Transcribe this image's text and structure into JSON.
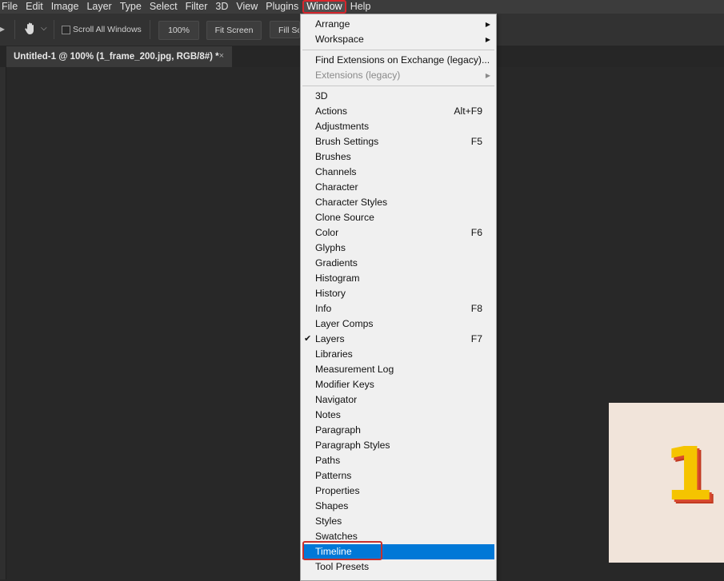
{
  "menubar": {
    "items": [
      "File",
      "Edit",
      "Image",
      "Layer",
      "Type",
      "Select",
      "Filter",
      "3D",
      "View",
      "Plugins",
      "Window",
      "Help"
    ],
    "active": "Window"
  },
  "options": {
    "scroll_all_windows": "Scroll All Windows",
    "zoom_value": "100%",
    "fit_screen": "Fit Screen",
    "fill_screen": "Fill Sc"
  },
  "document": {
    "tab_title": "Untitled-1 @ 100% (1_frame_200.jpg, RGB/8#) *",
    "close_glyph": "×",
    "canvas_number": "1"
  },
  "window_menu": {
    "group1": [
      {
        "label": "Arrange",
        "submenu": true
      },
      {
        "label": "Workspace",
        "submenu": true
      }
    ],
    "group2": [
      {
        "label": "Find Extensions on Exchange (legacy)...",
        "disabled": false
      },
      {
        "label": "Extensions (legacy)",
        "disabled": true,
        "submenu": true
      }
    ],
    "panels": [
      {
        "label": "3D"
      },
      {
        "label": "Actions",
        "shortcut": "Alt+F9"
      },
      {
        "label": "Adjustments"
      },
      {
        "label": "Brush Settings",
        "shortcut": "F5"
      },
      {
        "label": "Brushes"
      },
      {
        "label": "Channels"
      },
      {
        "label": "Character"
      },
      {
        "label": "Character Styles"
      },
      {
        "label": "Clone Source"
      },
      {
        "label": "Color",
        "shortcut": "F6"
      },
      {
        "label": "Glyphs"
      },
      {
        "label": "Gradients"
      },
      {
        "label": "Histogram"
      },
      {
        "label": "History"
      },
      {
        "label": "Info",
        "shortcut": "F8"
      },
      {
        "label": "Layer Comps"
      },
      {
        "label": "Layers",
        "shortcut": "F7",
        "checked": true
      },
      {
        "label": "Libraries"
      },
      {
        "label": "Measurement Log"
      },
      {
        "label": "Modifier Keys"
      },
      {
        "label": "Navigator"
      },
      {
        "label": "Notes"
      },
      {
        "label": "Paragraph"
      },
      {
        "label": "Paragraph Styles"
      },
      {
        "label": "Paths"
      },
      {
        "label": "Patterns"
      },
      {
        "label": "Properties"
      },
      {
        "label": "Shapes"
      },
      {
        "label": "Styles"
      },
      {
        "label": "Swatches"
      },
      {
        "label": "Timeline",
        "highlighted": true
      },
      {
        "label": "Tool Presets"
      }
    ],
    "checkmark_glyph": "✔",
    "submenu_glyph": "▶"
  },
  "colors": {
    "highlight": "#0078d7",
    "annotation": "#c9302c",
    "menu_bg": "#f0f0f0"
  }
}
